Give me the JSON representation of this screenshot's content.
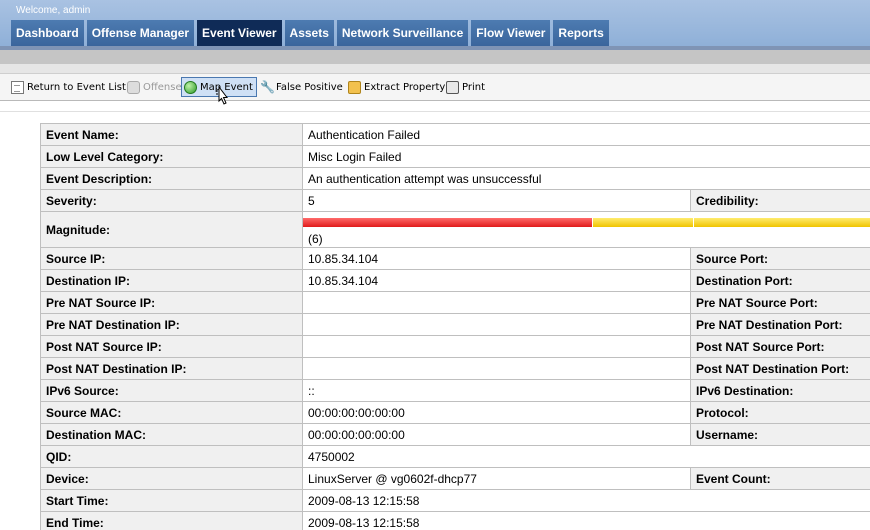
{
  "header": {
    "welcome": "Welcome, admin",
    "tabs": [
      {
        "label": "Dashboard",
        "active": false
      },
      {
        "label": "Offense Manager",
        "active": false
      },
      {
        "label": "Event Viewer",
        "active": true
      },
      {
        "label": "Assets",
        "active": false
      },
      {
        "label": "Network Surveillance",
        "active": false
      },
      {
        "label": "Flow Viewer",
        "active": false
      },
      {
        "label": "Reports",
        "active": false
      }
    ]
  },
  "toolbar": {
    "return_label": "Return to Event List",
    "offense_label": "Offense",
    "map_event_label": "Map Event",
    "false_positive_label": "False Positive",
    "extract_property_label": "Extract Property",
    "print_label": "Print"
  },
  "event": {
    "event_name": {
      "label": "Event Name:",
      "value": "Authentication Failed"
    },
    "low_level_category": {
      "label": "Low Level Category:",
      "value": "Misc Login Failed"
    },
    "event_description": {
      "label": "Event Description:",
      "value": "An authentication attempt was unsuccessful"
    },
    "severity": {
      "label": "Severity:",
      "value": "5"
    },
    "credibility": {
      "label": "Credibility:"
    },
    "magnitude": {
      "label": "Magnitude:",
      "value": "(6)",
      "level": 6
    },
    "source_ip": {
      "label": "Source IP:",
      "value": "10.85.34.104"
    },
    "source_port": {
      "label": "Source Port:"
    },
    "destination_ip": {
      "label": "Destination IP:",
      "value": "10.85.34.104"
    },
    "destination_port": {
      "label": "Destination Port:"
    },
    "pre_nat_source_ip": {
      "label": "Pre NAT Source IP:",
      "value": ""
    },
    "pre_nat_source_port": {
      "label": "Pre NAT Source Port:"
    },
    "pre_nat_destination_ip": {
      "label": "Pre NAT Destination IP:",
      "value": ""
    },
    "pre_nat_destination_port": {
      "label": "Pre NAT Destination Port:"
    },
    "post_nat_source_ip": {
      "label": "Post NAT Source IP:",
      "value": ""
    },
    "post_nat_source_port": {
      "label": "Post NAT Source Port:"
    },
    "post_nat_destination_ip": {
      "label": "Post NAT Destination IP:",
      "value": ""
    },
    "post_nat_destination_port": {
      "label": "Post NAT Destination Port:"
    },
    "ipv6_source": {
      "label": "IPv6 Source:",
      "value": "::"
    },
    "ipv6_destination": {
      "label": "IPv6 Destination:"
    },
    "source_mac": {
      "label": "Source MAC:",
      "value": "00:00:00:00:00:00"
    },
    "protocol": {
      "label": "Protocol:"
    },
    "destination_mac": {
      "label": "Destination MAC:",
      "value": "00:00:00:00:00:00"
    },
    "username": {
      "label": "Username:"
    },
    "qid": {
      "label": "QID:",
      "value": "4750002"
    },
    "device": {
      "label": "Device:",
      "value": "LinuxServer @ vg0602f-dhcp77"
    },
    "event_count": {
      "label": "Event Count:"
    },
    "start_time": {
      "label": "Start Time:",
      "value": "2009-08-13 12:15:58"
    },
    "end_time": {
      "label": "End Time:",
      "value": "2009-08-13 12:15:58"
    }
  },
  "colors": {
    "header_bg": "#9bb8dd",
    "tab_bg": "#3f6aa1",
    "tab_active_bg": "#0f2b57",
    "magnitude_red": "#e01b1b",
    "magnitude_yellow": "#f0c400"
  }
}
